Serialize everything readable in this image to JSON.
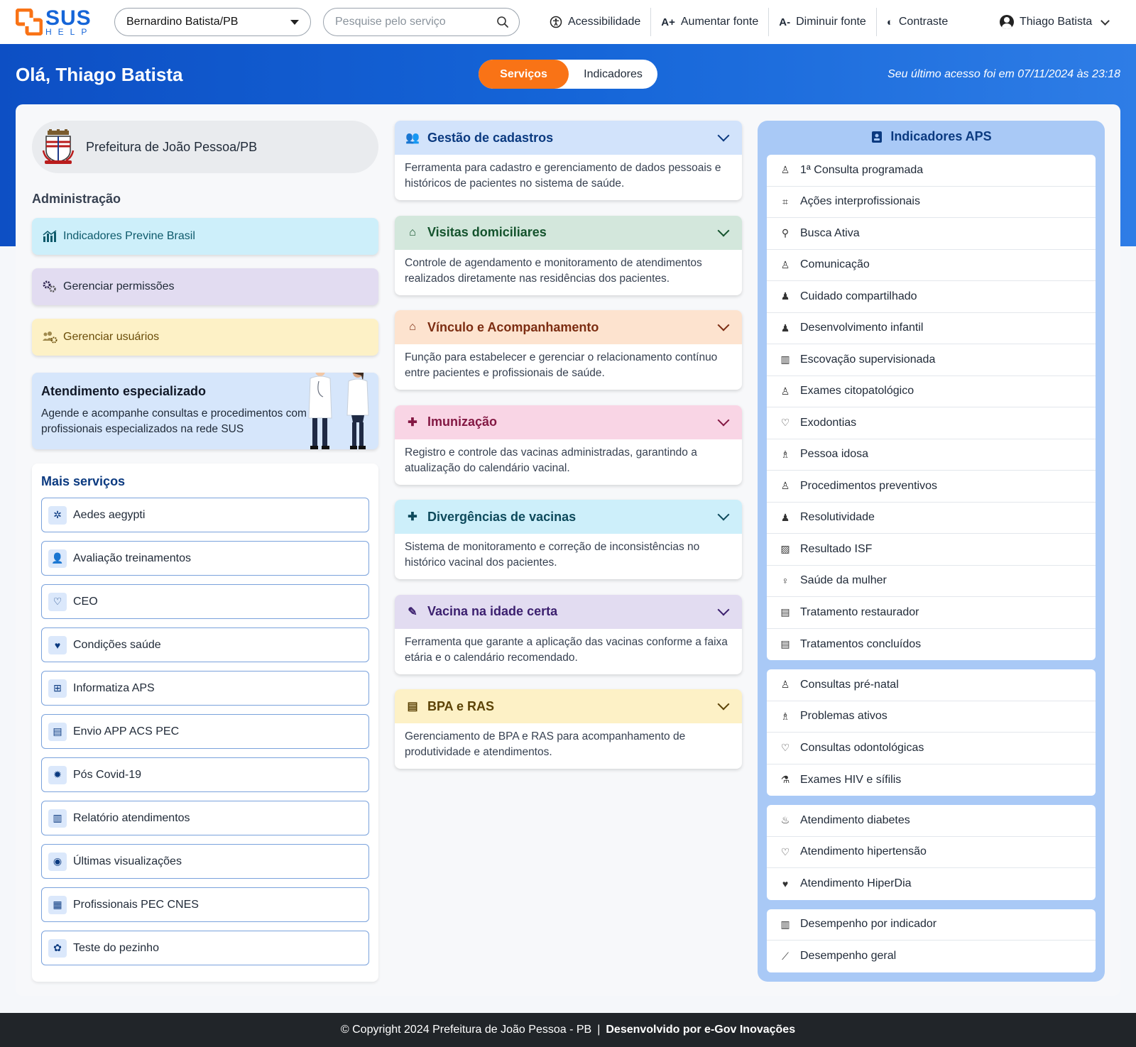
{
  "header": {
    "logo_text": "SUS",
    "logo_subtext": "HELP",
    "location_select": "Bernardino Batista/PB",
    "search_placeholder": "Pesquise pelo serviço",
    "actions": [
      {
        "icon": "accessibility-icon",
        "glyph": "♿",
        "label": "Acessibilidade"
      },
      {
        "icon": "font-increase-icon",
        "glyph": "A+",
        "label": "Aumentar fonte"
      },
      {
        "icon": "font-decrease-icon",
        "glyph": "A-",
        "label": "Diminuir fonte"
      },
      {
        "icon": "contrast-icon",
        "glyph": "◐",
        "label": "Contraste"
      }
    ],
    "user_name": "Thiago Batista"
  },
  "hero": {
    "greeting": "Olá, Thiago Batista",
    "tab_active": "Serviços",
    "tab_inactive": "Indicadores",
    "last_access": "Seu último acesso foi em 07/11/2024 às 23:18"
  },
  "prefecture": {
    "name": "Prefeitura de João Pessoa/PB"
  },
  "admin": {
    "title": "Administração",
    "items": [
      {
        "label": "Indicadores Previne Brasil",
        "icon": "chart-icon",
        "glyph": "📶",
        "bg": "#cdeffa",
        "fg": "#0e5a6b"
      },
      {
        "label": "Gerenciar permissões",
        "icon": "gears-icon",
        "glyph": "⚙",
        "bg": "#e2dcf1",
        "fg": "#1f2937"
      },
      {
        "label": "Gerenciar usuários",
        "icon": "users-gear-icon",
        "glyph": "👥",
        "bg": "#fdf1c6",
        "fg": "#6b4e0a"
      }
    ]
  },
  "specialized": {
    "title": "Atendimento especializado",
    "text": "Agende e acompanhe consultas e procedimentos com profissionais especializados na rede SUS"
  },
  "more_services": {
    "title": "Mais serviços",
    "items": [
      {
        "label": "Aedes aegypti",
        "icon": "mosquito-icon",
        "glyph": "✲"
      },
      {
        "label": "Avaliação treinamentos",
        "icon": "training-icon",
        "glyph": "👤"
      },
      {
        "label": "CEO",
        "icon": "tooth-icon",
        "glyph": "♡"
      },
      {
        "label": "Condições saúde",
        "icon": "heart-info-icon",
        "glyph": "♥"
      },
      {
        "label": "Informatiza APS",
        "icon": "laptop-plus-icon",
        "glyph": "⊞"
      },
      {
        "label": "Envio APP ACS PEC",
        "icon": "document-plus-icon",
        "glyph": "▤"
      },
      {
        "label": "Pós Covid-19",
        "icon": "virus-icon",
        "glyph": "✹"
      },
      {
        "label": "Relatório atendimentos",
        "icon": "clipboard-icon",
        "glyph": "▥"
      },
      {
        "label": "Últimas visualizações",
        "icon": "eye-icon",
        "glyph": "◉"
      },
      {
        "label": "Profissionais PEC CNES",
        "icon": "id-badge-icon",
        "glyph": "▦"
      },
      {
        "label": "Teste do pezinho",
        "icon": "baby-icon",
        "glyph": "✿"
      }
    ]
  },
  "services": [
    {
      "title": "Gestão de cadastros",
      "desc": "Ferramenta para cadastro e gerenciamento de dados pessoais e históricos de pacientes no sistema de saúde.",
      "icon": "users-icon",
      "glyph": "👥",
      "head_bg": "#d2e3fb",
      "color": "#0b3a80"
    },
    {
      "title": "Visitas domiciliares",
      "desc": "Controle de agendamento e monitoramento de atendimentos realizados diretamente nas residências dos pacientes.",
      "icon": "house-medical-icon",
      "glyph": "⌂",
      "head_bg": "#d3e7dc",
      "color": "#14532d"
    },
    {
      "title": "Vínculo e Acompanhamento",
      "desc": "Função para estabelecer e gerenciar o relacionamento contínuo entre pacientes e profissionais de saúde.",
      "icon": "house-heart-icon",
      "glyph": "⌂",
      "head_bg": "#fde3cf",
      "color": "#7c2d12"
    },
    {
      "title": "Imunização",
      "desc": "Registro e controle das vacinas administradas, garantindo a atualização do calendário vacinal.",
      "icon": "medical-kit-icon",
      "glyph": "✚",
      "head_bg": "#f9d5e5",
      "color": "#831843"
    },
    {
      "title": "Divergências de vacinas",
      "desc": "Sistema de monitoramento e correção de inconsistências no histórico vacinal dos pacientes.",
      "icon": "clipboard-medical-icon",
      "glyph": "✚",
      "head_bg": "#cdeffa",
      "color": "#0e4a5c"
    },
    {
      "title": "Vacina na idade certa",
      "desc": "Ferramenta que garante a aplicação das vacinas conforme a faixa etária e o calendário recomendado.",
      "icon": "syringe-icon",
      "glyph": "✎",
      "head_bg": "#e2dcf1",
      "color": "#3b1f6e"
    },
    {
      "title": "BPA e RAS",
      "desc": "Gerenciamento de BPA e RAS para acompanhamento de produtividade e atendimentos.",
      "icon": "file-medical-icon",
      "glyph": "▤",
      "head_bg": "#fdf1c6",
      "color": "#5c4306"
    }
  ],
  "aps": {
    "title": "Indicadores APS",
    "groups": [
      [
        {
          "label": "1ª Consulta programada",
          "icon": "doctor-icon",
          "glyph": "♙"
        },
        {
          "label": "Ações interprofissionais",
          "icon": "team-scan-icon",
          "glyph": "⌗"
        },
        {
          "label": "Busca Ativa",
          "icon": "user-search-icon",
          "glyph": "⚲"
        },
        {
          "label": "Comunicação",
          "icon": "presenter-icon",
          "glyph": "♙"
        },
        {
          "label": "Cuidado compartilhado",
          "icon": "group-icon",
          "glyph": "♟"
        },
        {
          "label": "Desenvolvimento infantil",
          "icon": "family-icon",
          "glyph": "♟"
        },
        {
          "label": "Escovação supervisionada",
          "icon": "building-icon",
          "glyph": "▥"
        },
        {
          "label": "Exames citopatológico",
          "icon": "user-lock-icon",
          "glyph": "♙"
        },
        {
          "label": "Exodontias",
          "icon": "tooth-icon",
          "glyph": "♡"
        },
        {
          "label": "Pessoa idosa",
          "icon": "elderly-icon",
          "glyph": "♗"
        },
        {
          "label": "Procedimentos preventivos",
          "icon": "doctor-icon",
          "glyph": "♙"
        },
        {
          "label": "Resolutividade",
          "icon": "people-group-icon",
          "glyph": "♟"
        },
        {
          "label": "Resultado ISF",
          "icon": "chart-line-icon",
          "glyph": "▨"
        },
        {
          "label": "Saúde da mulher",
          "icon": "woman-icon",
          "glyph": "♀"
        },
        {
          "label": "Tratamento restaurador",
          "icon": "clipboard-plus-icon",
          "glyph": "▤"
        },
        {
          "label": "Tratamentos concluídos",
          "icon": "clipboard-list-icon",
          "glyph": "▤"
        }
      ],
      [
        {
          "label": "Consultas pré-natal",
          "icon": "doctor-icon",
          "glyph": "♙"
        },
        {
          "label": "Problemas ativos",
          "icon": "person-walking-icon",
          "glyph": "♗"
        },
        {
          "label": "Consultas odontológicas",
          "icon": "tooth-icon",
          "glyph": "♡"
        },
        {
          "label": "Exames HIV e sífilis",
          "icon": "microscope-icon",
          "glyph": "⚗"
        }
      ],
      [
        {
          "label": "Atendimento diabetes",
          "icon": "hand-holding-icon",
          "glyph": "♨"
        },
        {
          "label": "Atendimento hipertensão",
          "icon": "heart-outline-icon",
          "glyph": "♡"
        },
        {
          "label": "Atendimento HiperDia",
          "icon": "heart-pulse-icon",
          "glyph": "♥"
        }
      ],
      [
        {
          "label": "Desempenho por indicador",
          "icon": "bar-chart-icon",
          "glyph": "▥"
        },
        {
          "label": "Desempenho geral",
          "icon": "line-chart-icon",
          "glyph": "⟋"
        }
      ]
    ]
  },
  "footer": {
    "copyright": "© Copyright 2024 Prefeitura de João Pessoa - PB",
    "separator": "|",
    "developer": "Desenvolvido por e-Gov Inovações"
  },
  "colors": {
    "primary_blue": "#1565d8",
    "accent_orange": "#f97316",
    "dark_footer": "#212529"
  }
}
